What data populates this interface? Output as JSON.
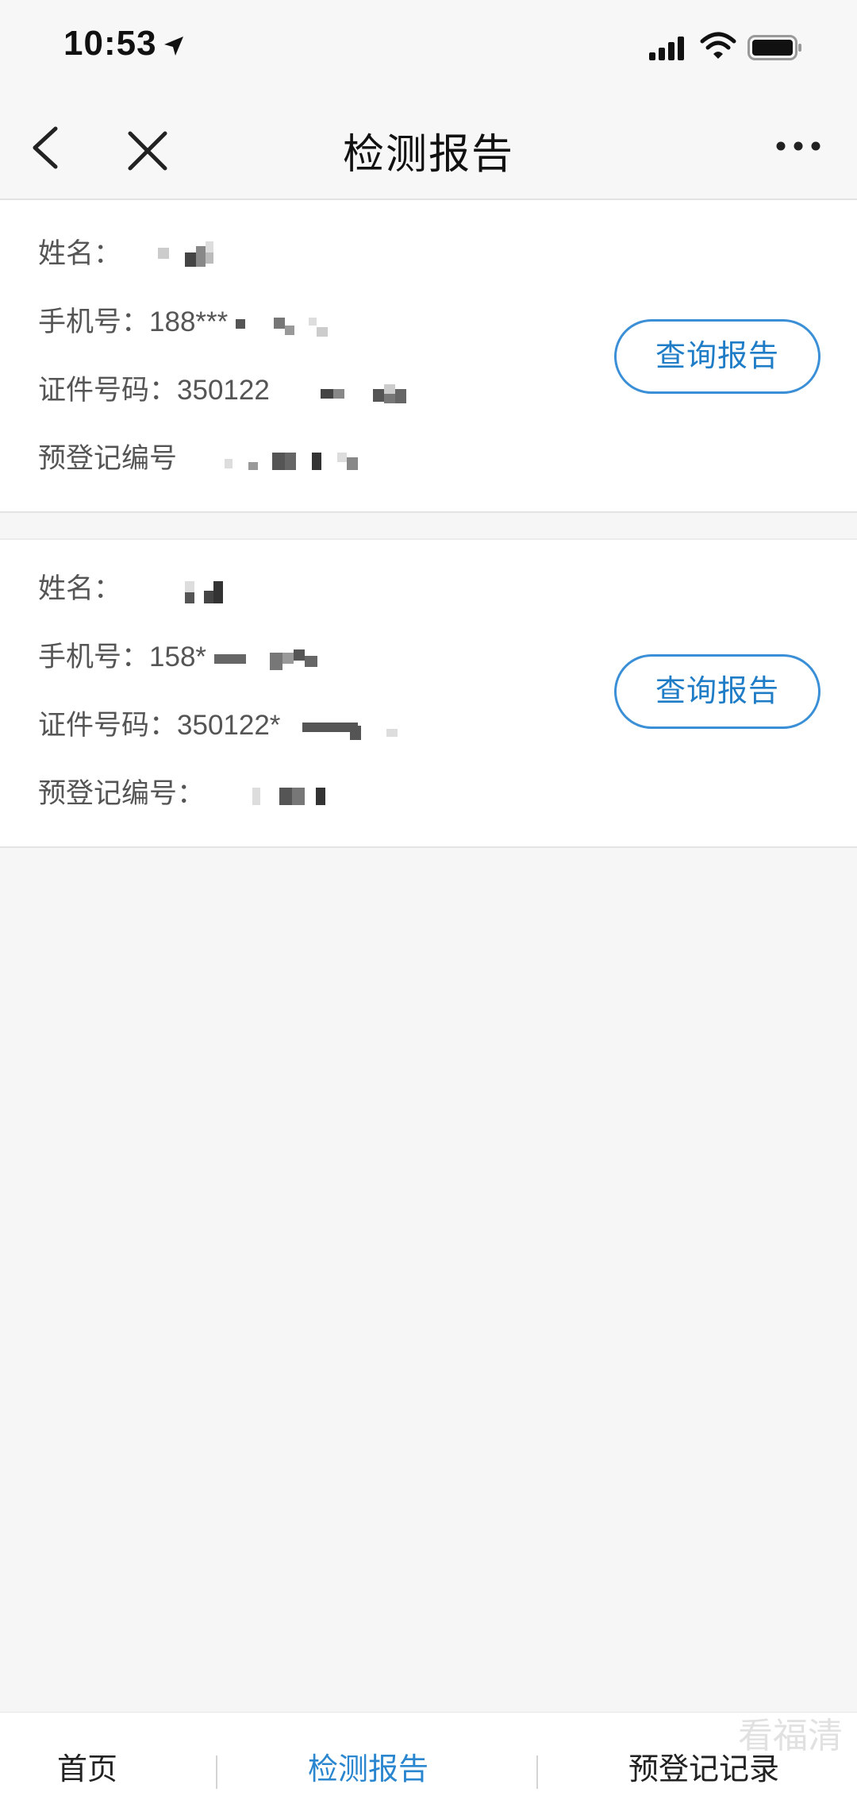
{
  "status_bar": {
    "time": "10:53"
  },
  "nav": {
    "title": "检测报告"
  },
  "records": [
    {
      "name_label": "姓名：",
      "phone_label": "手机号：",
      "phone_value": "188***",
      "id_label": "证件号码：",
      "id_value": "350122",
      "prereg_label": "预登记编号",
      "button_label": "查询报告"
    },
    {
      "name_label": "姓名：",
      "phone_label": "手机号：",
      "phone_value": "158*",
      "id_label": "证件号码：",
      "id_value": "350122*",
      "prereg_label": "预登记编号：",
      "button_label": "查询报告"
    }
  ],
  "tabs": [
    {
      "label": "首页",
      "active": false
    },
    {
      "label": "检测报告",
      "active": true
    },
    {
      "label": "预登记记录",
      "active": false
    }
  ],
  "watermark": "看福清",
  "colors": {
    "accent": "#2a86cf",
    "background": "#f6f6f6",
    "card": "#ffffff"
  }
}
